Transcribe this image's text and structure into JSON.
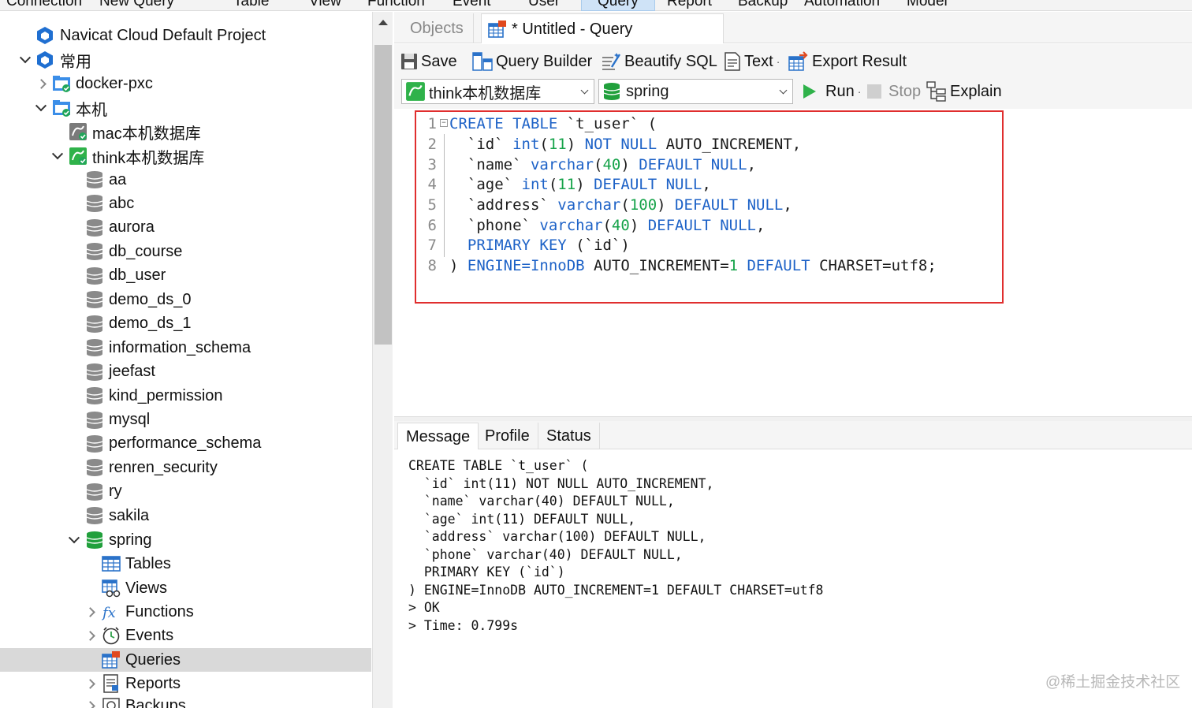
{
  "menu": [
    "Connection",
    "New Query",
    "Table",
    "View",
    "Function",
    "Event",
    "User",
    "Query",
    "Report",
    "Backup",
    "Automation",
    "Model"
  ],
  "menu_active": "Query",
  "tree": {
    "project": "Navicat Cloud Default Project",
    "group": "常用",
    "conn_docker": "docker-pxc",
    "conn_local": "本机",
    "db_mac": "mac本机数据库",
    "db_think": "think本机数据库",
    "schemas": [
      "aa",
      "abc",
      "aurora",
      "db_course",
      "db_user",
      "demo_ds_0",
      "demo_ds_1",
      "information_schema",
      "jeefast",
      "kind_permission",
      "mysql",
      "performance_schema",
      "renren_security",
      "ry",
      "sakila"
    ],
    "spring": "spring",
    "spring_children": [
      "Tables",
      "Views",
      "Functions",
      "Events",
      "Queries",
      "Reports",
      "Backups"
    ]
  },
  "tabs": {
    "objects": "Objects",
    "query": "* Untitled - Query"
  },
  "toolbar": {
    "save": "Save",
    "query_builder": "Query Builder",
    "beautify": "Beautify SQL",
    "text": "Text",
    "export": "Export Result",
    "connection": "think本机数据库",
    "database": "spring",
    "run": "Run",
    "stop": "Stop",
    "explain": "Explain"
  },
  "editor": {
    "line_numbers": [
      "1",
      "2",
      "3",
      "4",
      "5",
      "6",
      "7",
      "8"
    ],
    "lines": [
      "CREATE TABLE `t_user` (",
      "  `id` int(11) NOT NULL AUTO_INCREMENT,",
      "  `name` varchar(40) DEFAULT NULL,",
      "  `age` int(11) DEFAULT NULL,",
      "  `address` varchar(100) DEFAULT NULL,",
      "  `phone` varchar(40) DEFAULT NULL,",
      "  PRIMARY KEY (`id`)",
      ") ENGINE=InnoDB AUTO_INCREMENT=1 DEFAULT CHARSET=utf8;"
    ]
  },
  "result_tabs": [
    "Message",
    "Profile",
    "Status"
  ],
  "messages": [
    "CREATE TABLE `t_user` (",
    "  `id` int(11) NOT NULL AUTO_INCREMENT,",
    "  `name` varchar(40) DEFAULT NULL,",
    "  `age` int(11) DEFAULT NULL,",
    "  `address` varchar(100) DEFAULT NULL,",
    "  `phone` varchar(40) DEFAULT NULL,",
    "  PRIMARY KEY (`id`)",
    ") ENGINE=InnoDB AUTO_INCREMENT=1 DEFAULT CHARSET=utf8",
    "> OK",
    "> Time: 0.799s"
  ],
  "watermark": "@稀土掘金技术社区",
  "colors": {
    "keyword": "#1d62c7",
    "number": "#16a34a",
    "highlight": "#e02e2e",
    "selected_row": "#d9d9d9"
  }
}
